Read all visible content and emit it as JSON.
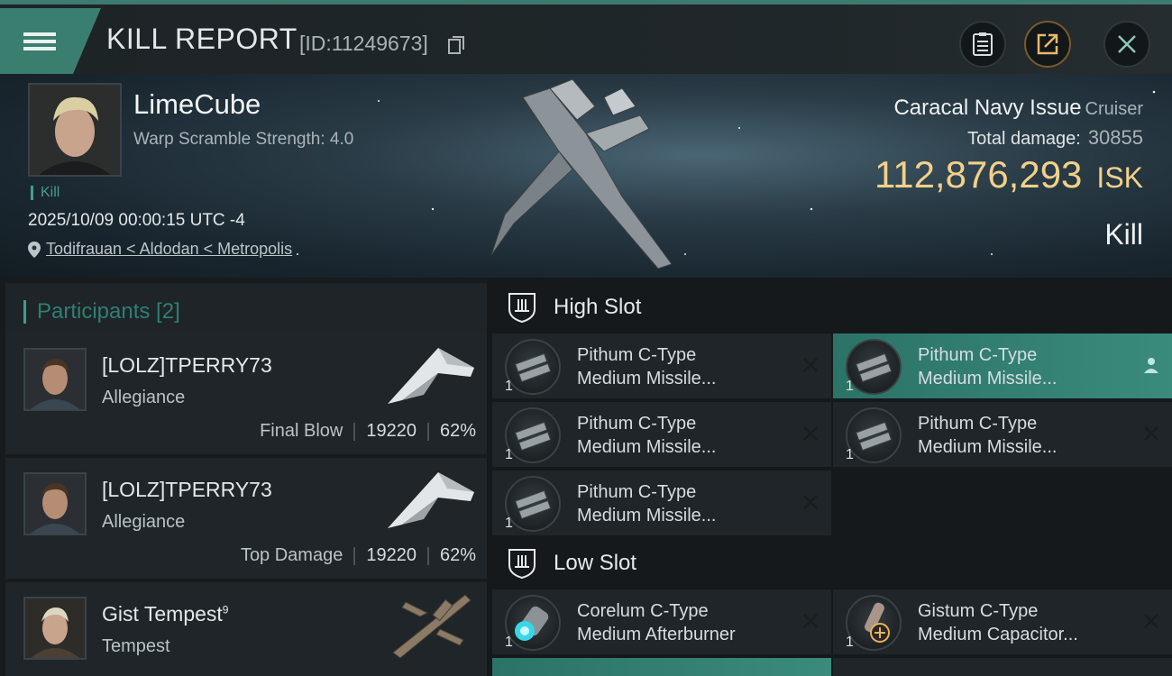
{
  "header": {
    "title": "KILL REPORT",
    "report_id": "[ID:11249673]",
    "icons": [
      "menu-icon",
      "copy-icon",
      "clipboard-icon",
      "share-icon",
      "close-icon"
    ]
  },
  "victim": {
    "name": "LimeCube",
    "warp_scramble": "Warp Scramble Strength: 4.0",
    "kill_tag": "Kill",
    "datetime": "2025/10/09 00:00:15 UTC -4",
    "location": "Todifrauan < Aldodan < Metropolis"
  },
  "ship": {
    "name": "Caracal Navy Issue",
    "class": "Cruiser",
    "total_damage_label": "Total damage:",
    "total_damage": "30855",
    "isk_value": "112,876,293",
    "isk_unit": "ISK",
    "result": "Kill"
  },
  "participants": {
    "title": "Participants [2]",
    "items": [
      {
        "name": "[LOLZ]TPERRY73",
        "ship": "Allegiance",
        "role": "Final Blow",
        "damage": "19220",
        "percent": "62%"
      },
      {
        "name": "[LOLZ]TPERRY73",
        "ship": "Allegiance",
        "role": "Top Damage",
        "damage": "19220",
        "percent": "62%"
      },
      {
        "name": "Gist Tempest",
        "name_sup": "9",
        "ship": "Tempest"
      }
    ]
  },
  "fitting": {
    "high_slot": {
      "label": "High Slot",
      "modules": [
        {
          "line1": "Pithum C-Type",
          "line2": "Medium Missile...",
          "qty": "1",
          "state": "destroyed"
        },
        {
          "line1": "Pithum C-Type",
          "line2": "Medium Missile...",
          "qty": "1",
          "state": "dropped"
        },
        {
          "line1": "Pithum C-Type",
          "line2": "Medium Missile...",
          "qty": "1",
          "state": "destroyed"
        },
        {
          "line1": "Pithum C-Type",
          "line2": "Medium Missile...",
          "qty": "1",
          "state": "destroyed"
        },
        {
          "line1": "Pithum C-Type",
          "line2": "Medium Missile...",
          "qty": "1",
          "state": "destroyed"
        }
      ]
    },
    "low_slot": {
      "label": "Low Slot",
      "modules": [
        {
          "line1": "Corelum C-Type",
          "line2": "Medium Afterburner",
          "qty": "1",
          "state": "destroyed"
        },
        {
          "line1": "Gistum C-Type",
          "line2": "Medium Capacitor...",
          "qty": "1",
          "state": "destroyed"
        }
      ]
    }
  },
  "colors": {
    "accent": "#3a7e70",
    "isk": "#f3d08a",
    "highlight": "#3a8b7c"
  }
}
